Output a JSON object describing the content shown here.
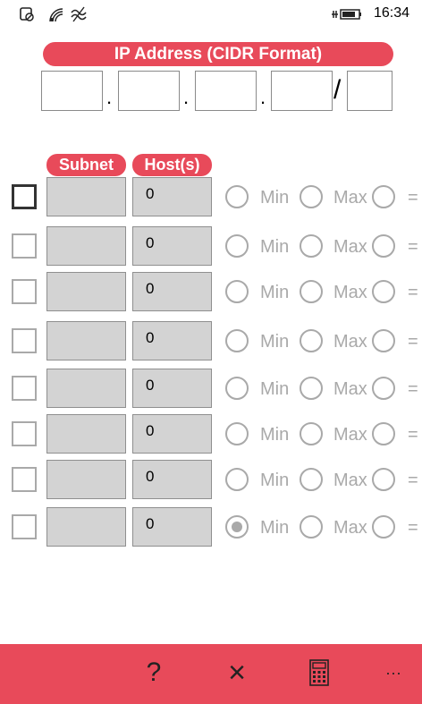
{
  "status_bar": {
    "time": "16:34",
    "icons": [
      "location-off-icon",
      "wifi-icon",
      "network-icon",
      "battery-charging-icon"
    ]
  },
  "ip_title": "IP Address (CIDR Format)",
  "ip_fields": {
    "separator_dot": ".",
    "separator_slash": "/",
    "octets": [
      "",
      "",
      "",
      ""
    ],
    "prefix": ""
  },
  "columns": {
    "subnet": "Subnet",
    "hosts": "Host(s)"
  },
  "rows": [
    {
      "subnet": "",
      "hosts": "0",
      "min_label": "Min",
      "max_label": "Max",
      "eq": "=",
      "selected": ""
    },
    {
      "subnet": "",
      "hosts": "0",
      "min_label": "Min",
      "max_label": "Max",
      "eq": "=",
      "selected": ""
    },
    {
      "subnet": "",
      "hosts": "0",
      "min_label": "Min",
      "max_label": "Max",
      "eq": "=",
      "selected": ""
    },
    {
      "subnet": "",
      "hosts": "0",
      "min_label": "Min",
      "max_label": "Max",
      "eq": "=",
      "selected": ""
    },
    {
      "subnet": "",
      "hosts": "0",
      "min_label": "Min",
      "max_label": "Max",
      "eq": "=",
      "selected": ""
    },
    {
      "subnet": "",
      "hosts": "0",
      "min_label": "Min",
      "max_label": "Max",
      "eq": "=",
      "selected": ""
    },
    {
      "subnet": "",
      "hosts": "0",
      "min_label": "Min",
      "max_label": "Max",
      "eq": "=",
      "selected": ""
    },
    {
      "subnet": "",
      "hosts": "0",
      "min_label": "Min",
      "max_label": "Max",
      "eq": "=",
      "selected": "min"
    }
  ],
  "app_bar": {
    "help": "?",
    "clear": "×",
    "more": "···",
    "icons": [
      "help-icon",
      "clear-icon",
      "calculator-icon",
      "more-icon"
    ]
  },
  "colors": {
    "accent": "#e84a5a",
    "field_gray": "#d3d3d3",
    "control_gray": "#a9a9a9"
  }
}
